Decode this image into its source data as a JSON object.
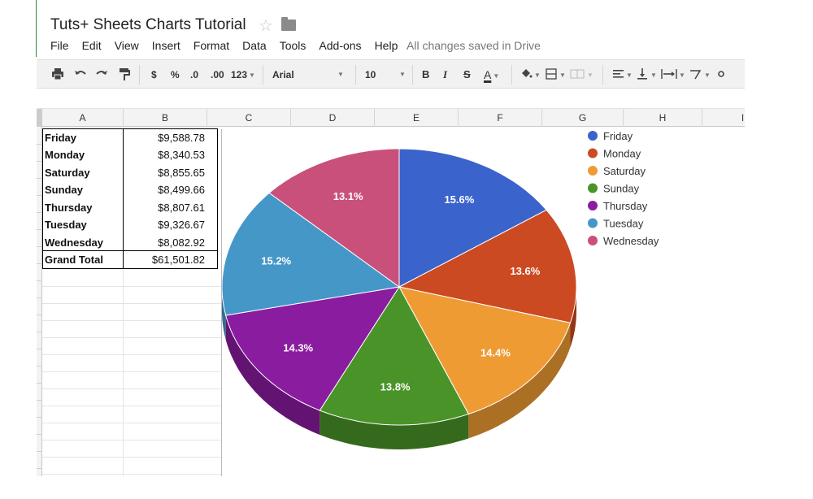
{
  "doc": {
    "title": "Tuts+ Sheets Charts Tutorial",
    "star_glyph": "☆",
    "save_status": "All changes saved in Drive"
  },
  "menu": [
    "File",
    "Edit",
    "View",
    "Insert",
    "Format",
    "Data",
    "Tools",
    "Add-ons",
    "Help"
  ],
  "toolbar": {
    "currency": "$",
    "percent": "%",
    "dec_less": ".0",
    "dec_more": ".00",
    "more_formats": "123",
    "font": "Arial",
    "font_size": "10",
    "bold": "B",
    "italic": "I",
    "strike": "S",
    "text_color": "A"
  },
  "grid": {
    "columns": [
      "A",
      "B",
      "C",
      "D",
      "E",
      "F",
      "G",
      "H",
      "I"
    ],
    "rows": [
      {
        "day": "Friday",
        "amount": "$9,588.78"
      },
      {
        "day": "Monday",
        "amount": "$8,340.53"
      },
      {
        "day": "Saturday",
        "amount": "$8,855.65"
      },
      {
        "day": "Sunday",
        "amount": "$8,499.66"
      },
      {
        "day": "Thursday",
        "amount": "$8,807.61"
      },
      {
        "day": "Tuesday",
        "amount": "$9,326.67"
      },
      {
        "day": "Wednesday",
        "amount": "$8,082.92"
      }
    ],
    "total": {
      "label": "Grand Total",
      "amount": "$61,501.82"
    }
  },
  "chart_data": {
    "type": "pie",
    "variant": "3d",
    "legend_position": "right",
    "categories": [
      "Friday",
      "Monday",
      "Saturday",
      "Sunday",
      "Thursday",
      "Tuesday",
      "Wednesday"
    ],
    "values": [
      15.6,
      13.6,
      14.4,
      13.8,
      14.3,
      15.2,
      13.1
    ],
    "labels": [
      "15.6%",
      "13.6%",
      "14.4%",
      "13.8%",
      "14.3%",
      "15.2%",
      "13.1%"
    ],
    "colors": [
      "#3b63cc",
      "#cc4a22",
      "#ef9b34",
      "#4a9328",
      "#8a1ca0",
      "#4597c8",
      "#c9507a"
    ]
  }
}
